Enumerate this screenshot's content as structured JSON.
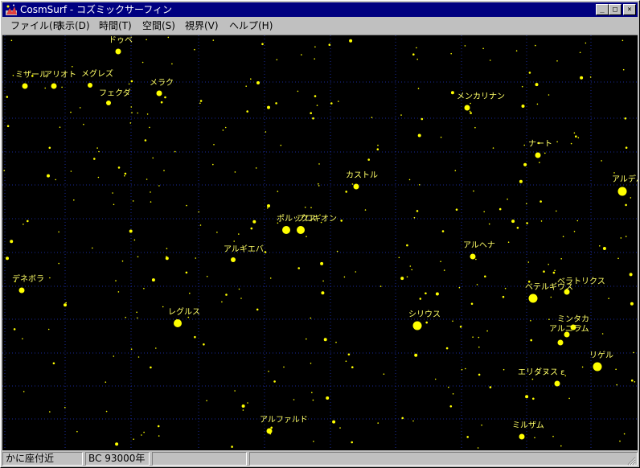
{
  "window": {
    "title": "CosmSurf - コズミックサーフィン",
    "minimize_glyph": "_",
    "maximize_glyph": "□",
    "close_glyph": "×"
  },
  "menu": {
    "items": [
      {
        "id": "file",
        "label": "ファイル(F)"
      },
      {
        "id": "view",
        "label": "表示(D)"
      },
      {
        "id": "time",
        "label": "時間(T)"
      },
      {
        "id": "space",
        "label": "空間(S)"
      },
      {
        "id": "fov",
        "label": "視界(V)"
      },
      {
        "id": "help",
        "label": "ヘルプ(H)"
      }
    ]
  },
  "sky": {
    "background_color": "#000000",
    "grid_color": "#1a2a9a",
    "star_color": "#ffff00",
    "label_color": "#ffff66",
    "labels": {
      "dubhe": "ドゥベ",
      "mizar": "ミザール",
      "alioth": "アリオト",
      "megrez": "メグレズ",
      "phecda": "フェクダ",
      "merak": "メラク",
      "menkalinan": "メンカリナン",
      "nath": "ナート",
      "castor": "カストル",
      "aldebaran": "アルデバ",
      "pollux": "ポルックス",
      "procyon": "プロキオン",
      "algieba": "アルギエバ",
      "alhena": "アルヘナ",
      "denebola": "デネボラ",
      "betelgeuse": "ベテルギウス",
      "bellatrix": "ベラトリクス",
      "regulus": "レグルス",
      "sirius": "シリウス",
      "mintaka": "ミンタカ",
      "alnilam": "アルニラム",
      "rigel": "リゲル",
      "eridanus": "エリダヌス ε",
      "alphard": "アルファルド",
      "mirzam": "ミルザム"
    }
  },
  "status": {
    "location": "かに座付近",
    "epoch": "BC 93000年",
    "panel3": "",
    "panel4": ""
  }
}
